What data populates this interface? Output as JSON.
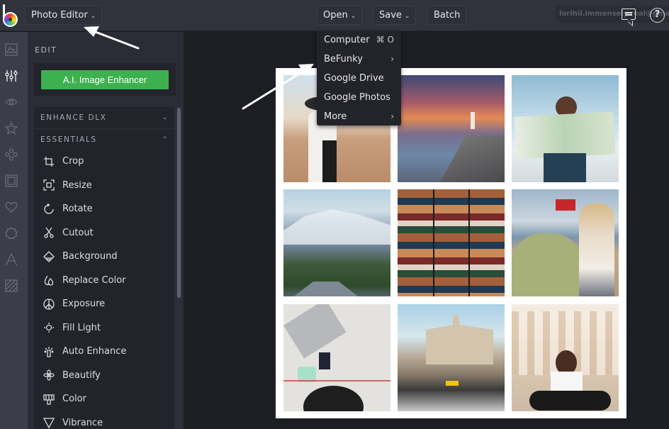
{
  "topbar": {
    "logo": "befunky-logo",
    "mode_selector": "Photo Editor",
    "open_label": "Open",
    "save_label": "Save",
    "batch_label": "Batch",
    "user_email": "lorihil.immensely.real@gmail.",
    "chat_icon": "chat-icon",
    "help_icon": "?"
  },
  "open_menu": {
    "items": [
      {
        "label": "Computer",
        "shortcut": "⌘ O"
      },
      {
        "label": "BeFunky",
        "submenu": "›"
      },
      {
        "label": "Google Drive"
      },
      {
        "label": "Google Photos"
      },
      {
        "label": "More",
        "submenu": "›"
      }
    ]
  },
  "rail": {
    "items": [
      "image-manager",
      "edit",
      "touch-up",
      "effects",
      "artsy",
      "frames",
      "graphics",
      "overlays",
      "text",
      "textures"
    ]
  },
  "panel": {
    "title": "EDIT",
    "enhancer_label": "A.I. Image Enhancer",
    "sections": [
      {
        "label": "ENHANCE DLX",
        "state": "collapsed",
        "chevron": "⌄"
      },
      {
        "label": "ESSENTIALS",
        "state": "expanded",
        "chevron": "⌃"
      }
    ],
    "tools": [
      {
        "label": "Crop",
        "icon": "crop-icon"
      },
      {
        "label": "Resize",
        "icon": "resize-icon"
      },
      {
        "label": "Rotate",
        "icon": "rotate-icon"
      },
      {
        "label": "Cutout",
        "icon": "scissors-icon"
      },
      {
        "label": "Background",
        "icon": "background-icon"
      },
      {
        "label": "Replace Color",
        "icon": "drops-icon"
      },
      {
        "label": "Exposure",
        "icon": "exposure-icon"
      },
      {
        "label": "Fill Light",
        "icon": "fill-light-icon"
      },
      {
        "label": "Auto Enhance",
        "icon": "auto-enhance-icon"
      },
      {
        "label": "Beautify",
        "icon": "beautify-icon"
      },
      {
        "label": "Color",
        "icon": "color-icon"
      },
      {
        "label": "Vibrance",
        "icon": "vibrance-icon"
      }
    ]
  },
  "collage": {
    "photos": [
      {
        "subject": "woman-in-hat-with-camera"
      },
      {
        "subject": "lighthouse-sunset-rocks"
      },
      {
        "subject": "woman-reading-map"
      },
      {
        "subject": "snowy-mountain-road"
      },
      {
        "subject": "stacked-vintage-suitcases"
      },
      {
        "subject": "woman-with-vintage-car"
      },
      {
        "subject": "map-laptop-passport-flatlay"
      },
      {
        "subject": "havana-taxi-convertible"
      },
      {
        "subject": "man-sitting-at-acropolis"
      }
    ]
  },
  "colors": {
    "accent_green": "#3db14f",
    "topbar_bg": "#30323c",
    "panel_bg": "#2b2c35",
    "canvas_bg": "#1d1e23"
  }
}
